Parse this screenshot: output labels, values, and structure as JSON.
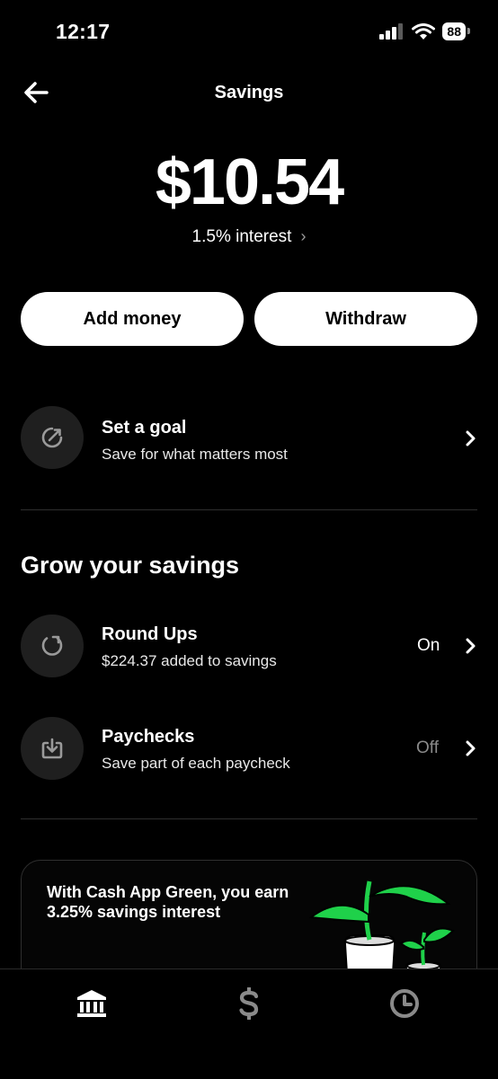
{
  "status_bar": {
    "time": "12:17",
    "battery": "88"
  },
  "header": {
    "title": "Savings"
  },
  "balance": {
    "amount": "$10.54",
    "interest": "1.5% interest"
  },
  "actions": {
    "add_money": "Add money",
    "withdraw": "Withdraw"
  },
  "goal": {
    "title": "Set a goal",
    "subtitle": "Save for what matters most"
  },
  "grow": {
    "title": "Grow your savings",
    "items": [
      {
        "title": "Round Ups",
        "subtitle": "$224.37 added to savings",
        "status": "On"
      },
      {
        "title": "Paychecks",
        "subtitle": "Save part of each paycheck",
        "status": "Off"
      }
    ]
  },
  "promo": {
    "text": "With Cash App Green, you earn 3.25% savings interest"
  },
  "tabs": [
    "bank-icon",
    "dollar-icon",
    "clock-icon"
  ],
  "colors": {
    "background": "#000000",
    "accent_green": "#1fd14a",
    "text_muted": "#9a9a9a"
  }
}
